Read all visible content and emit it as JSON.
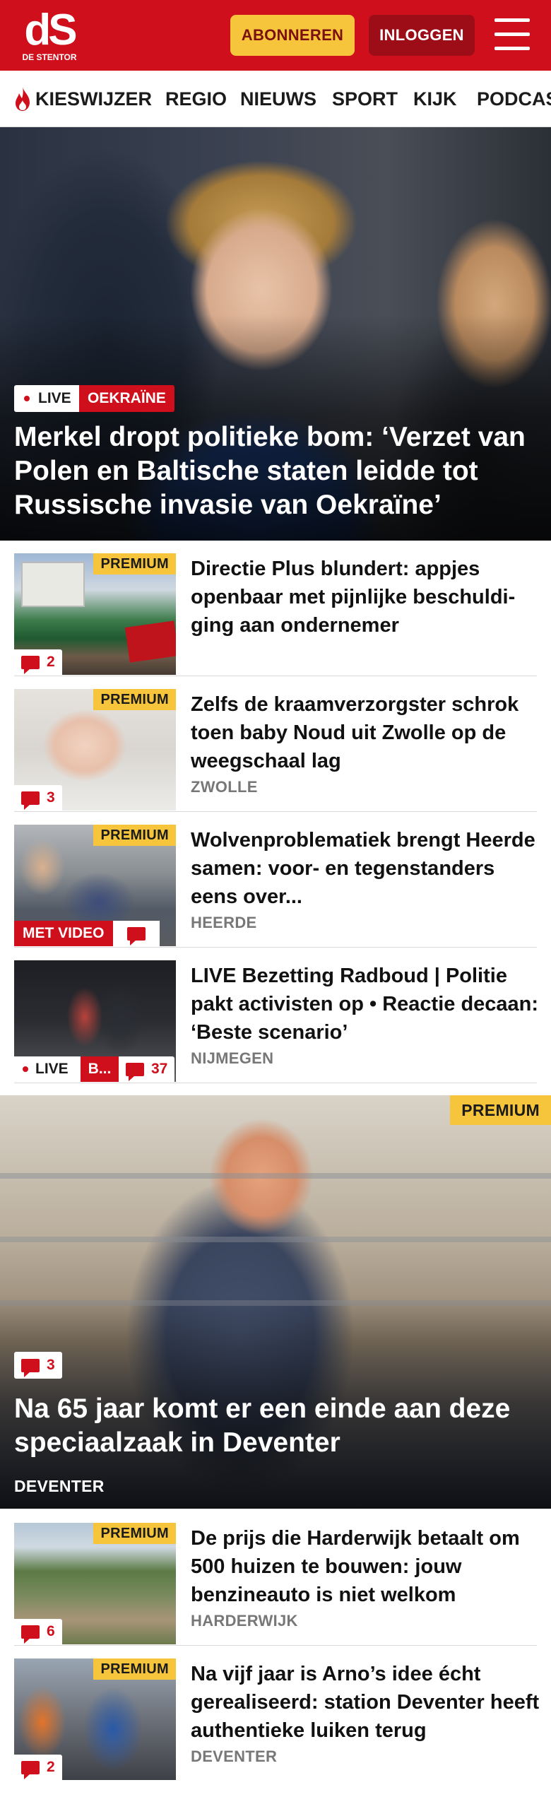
{
  "header": {
    "logo_mark": "dS",
    "logo_sub": "DE STENTOR",
    "subscribe_label": "ABONNEREN",
    "login_label": "INLOGGEN"
  },
  "nav": {
    "items": [
      "KIESWIJZER",
      "REGIO",
      "NIEUWS",
      "SPORT",
      "KIJK",
      "PODCAST"
    ]
  },
  "hero": {
    "live_label": "LIVE",
    "tag": "OEKRAÏNE",
    "title": "Merkel dropt politieke bom: ‘Verzet van Polen en Baltische staten leidde tot Russische invasie van Oekraïne’"
  },
  "articles": [
    {
      "premium": "PREMIUM",
      "comments": "2",
      "title": "Directie Plus blundert: appjes openbaar met pijnlijke beschuldi-ging aan ondernemer",
      "location": ""
    },
    {
      "premium": "PREMIUM",
      "comments": "3",
      "title": "Zelfs de kraamverzorgster schrok toen baby Noud uit Zwolle op de weegschaal lag",
      "location": "ZWOLLE"
    },
    {
      "premium": "PREMIUM",
      "video_label": "MET VIDEO",
      "title": "Wolvenproblematiek brengt Heerde samen: voor- en tegenstanders eens over...",
      "location": "HEERDE"
    },
    {
      "live_label": "LIVE",
      "tag_short": "B...",
      "comments": "37",
      "title": "LIVE Bezetting Radboud | Politie pakt activisten op • Reactie decaan: ‘Beste scenario’",
      "location": "NIJMEGEN"
    }
  ],
  "feature": {
    "premium": "PREMIUM",
    "comments": "3",
    "title": "Na 65 jaar komt er een einde aan deze speciaalzaak in Deventer",
    "location": "DEVENTER"
  },
  "articles_bottom": [
    {
      "premium": "PREMIUM",
      "comments": "6",
      "title": "De prijs die Harderwijk betaalt om 500 huizen te bouwen: jouw benzineauto is niet welkom",
      "location": "HARDERWIJK"
    },
    {
      "premium": "PREMIUM",
      "comments": "2",
      "title": "Na vijf jaar is Arno’s idee écht gerealiseerd: station Deventer heeft authentieke luiken terug",
      "location": "DEVENTER"
    }
  ],
  "colors": {
    "brand_red": "#d00f1d",
    "premium_yellow": "#f6c53b",
    "login_dark_red": "#9d0d17"
  },
  "icons": [
    "flame-icon",
    "hamburger-menu-icon",
    "comment-icon",
    "live-dot-icon"
  ]
}
